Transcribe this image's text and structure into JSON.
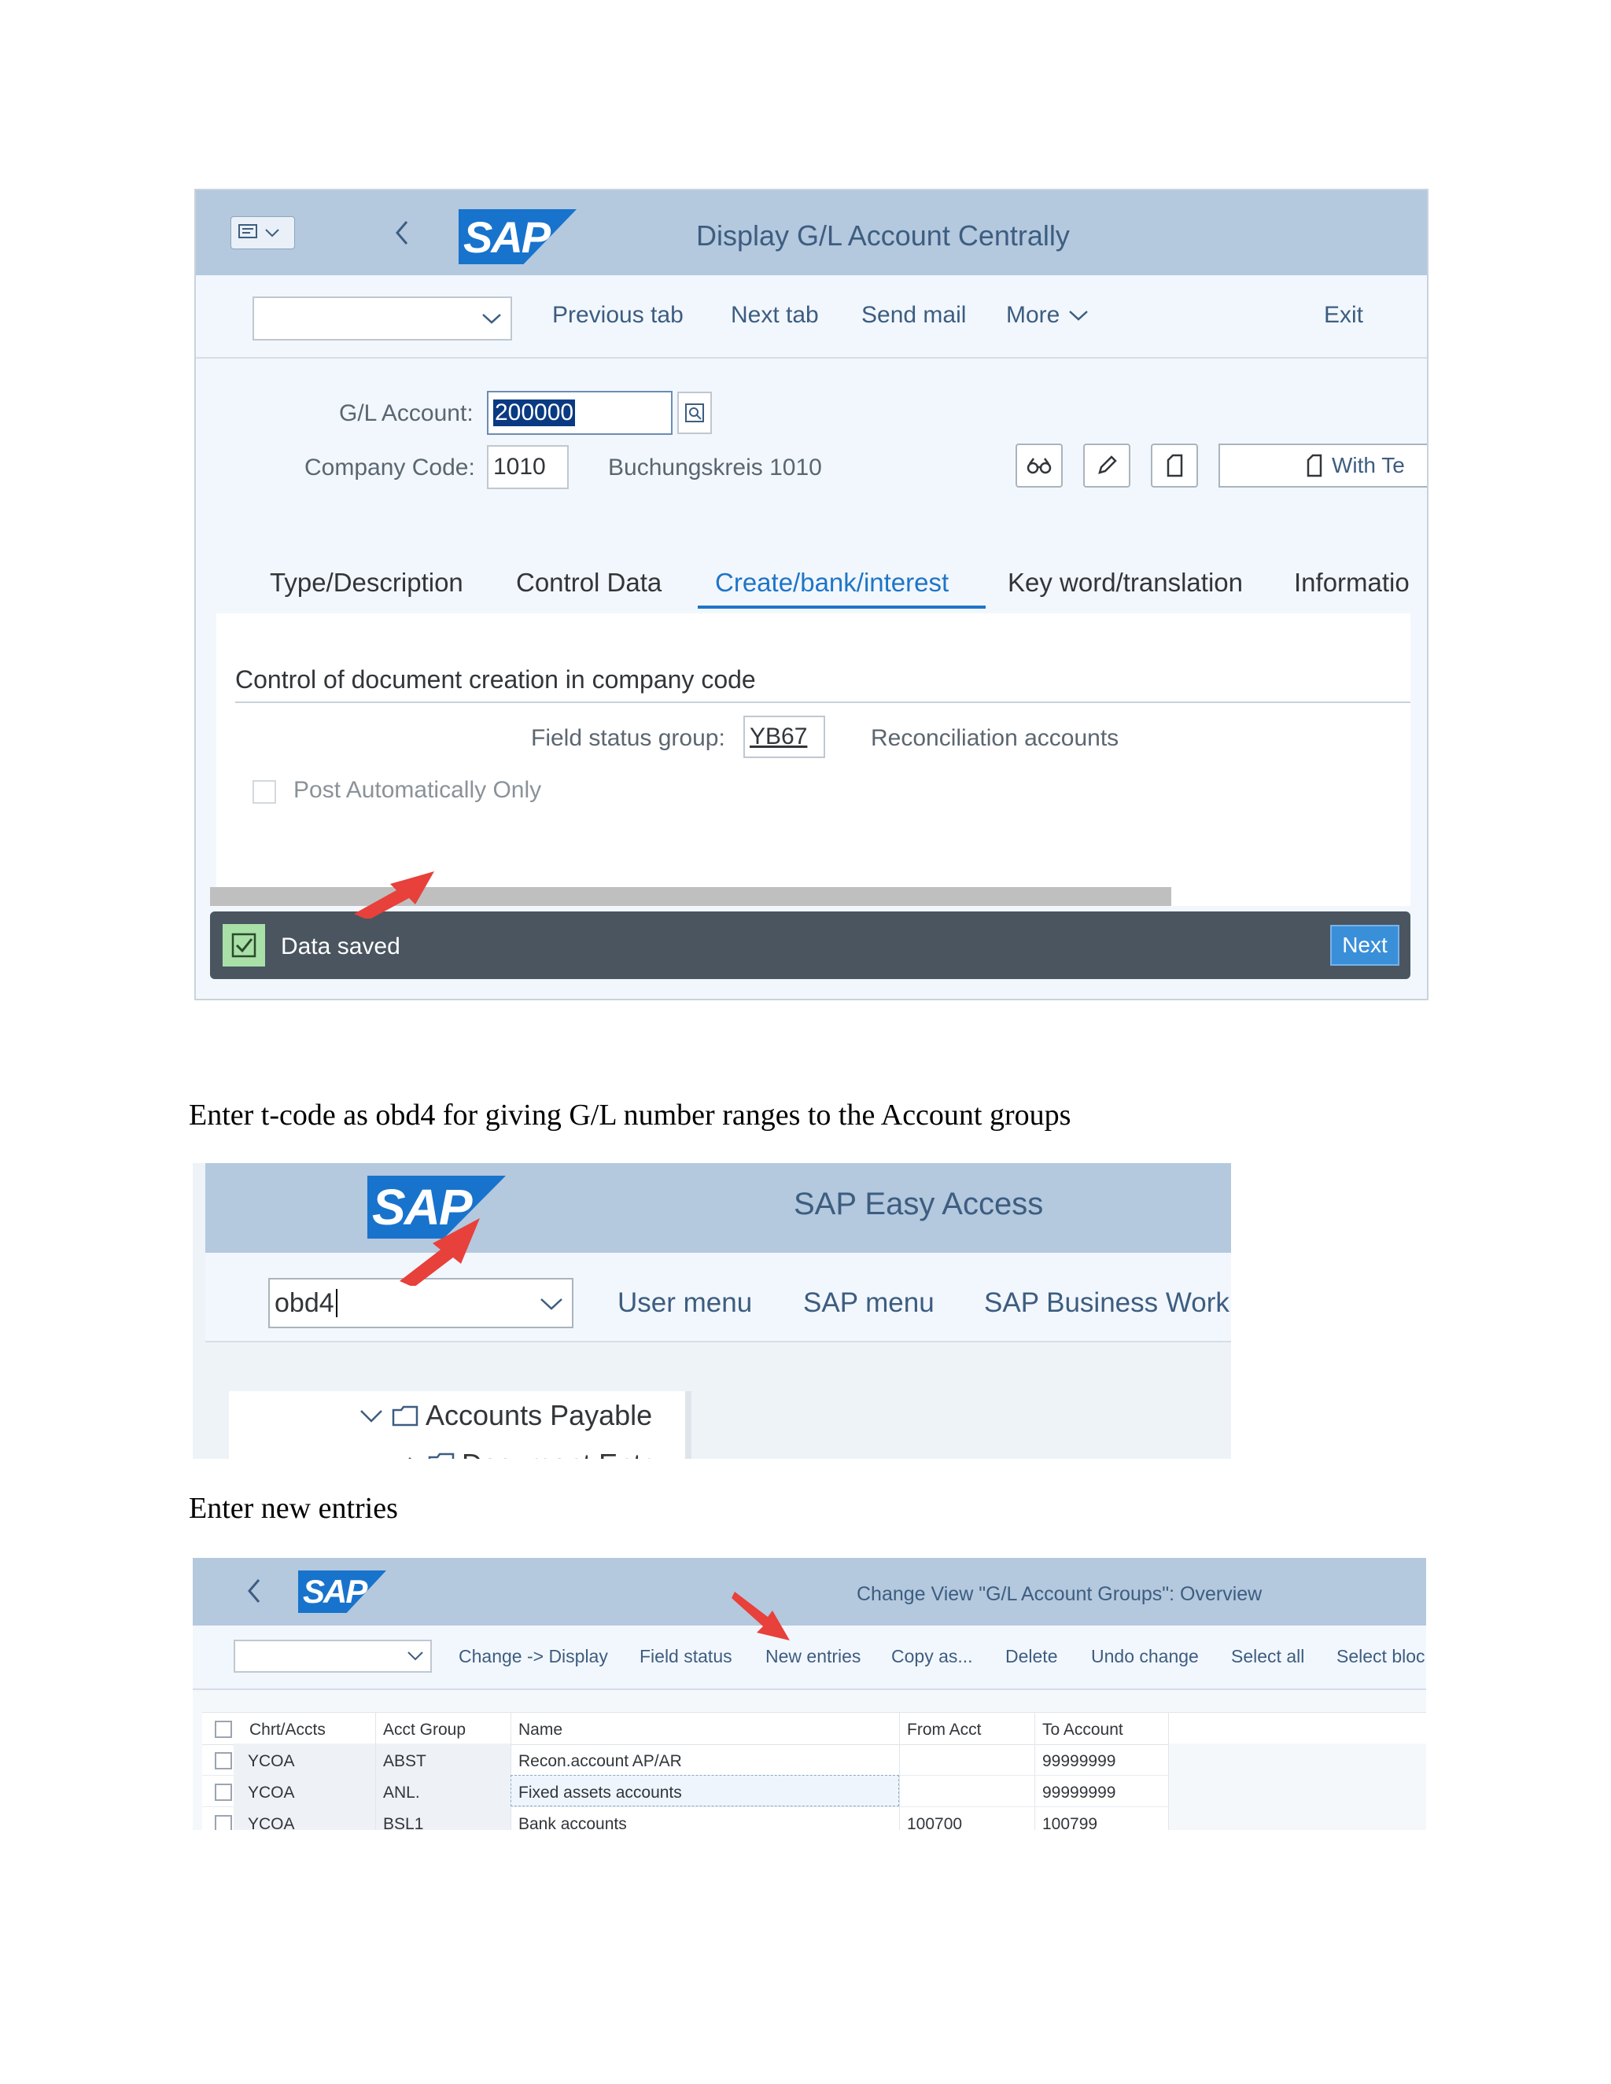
{
  "screen1": {
    "title": "Display G/L Account Centrally",
    "toolbar": {
      "previous_tab": "Previous tab",
      "next_tab": "Next tab",
      "send_mail": "Send mail",
      "more": "More",
      "exit": "Exit"
    },
    "gl_account_label": "G/L Account:",
    "gl_account_value": "200000",
    "company_code_label": "Company Code:",
    "company_code_value": "1010",
    "company_name": "Buchungskreis 1010",
    "with_template_button": "With Te",
    "tabs": [
      "Type/Description",
      "Control Data",
      "Create/bank/interest",
      "Key word/translation",
      "Informatio"
    ],
    "section_title": "Control of document creation in company code",
    "field_status_label": "Field status group:",
    "field_status_value": "YB67",
    "field_status_desc": "Reconciliation accounts",
    "post_auto_label": "Post Automatically Only",
    "message": "Data saved",
    "next_button": "Next"
  },
  "instruction1": "Enter t-code as obd4 for giving G/L number ranges to the Account groups",
  "screen2": {
    "title": "SAP Easy Access",
    "command_value": "obd4",
    "menu": [
      "User menu",
      "SAP menu",
      "SAP Business Work"
    ],
    "tree_item": "Accounts Payable",
    "tree_item_cut": "Document Entry"
  },
  "instruction2": "Enter new entries",
  "screen3": {
    "title": "Change View \"G/L Account Groups\": Overview",
    "toolbar": [
      "Change -> Display",
      "Field status",
      "New entries",
      "Copy as...",
      "Delete",
      "Undo change",
      "Select all",
      "Select bloc"
    ],
    "columns": [
      "Chrt/Accts",
      "Acct Group",
      "Name",
      "From Acct",
      "To Account"
    ],
    "rows": [
      {
        "chart": "YCOA",
        "group": "ABST",
        "name": "Recon.account AP/AR",
        "from": "",
        "to": "99999999"
      },
      {
        "chart": "YCOA",
        "group": "ANL.",
        "name": "Fixed assets accounts",
        "from": "",
        "to": "99999999"
      },
      {
        "chart": "YCOA",
        "group": "BSL1",
        "name": "Bank accounts",
        "from": "100700",
        "to": "100799"
      }
    ]
  },
  "logo_text": "SAP",
  "colors": {
    "shell": "#b4c8de",
    "accent_blue": "#1e75c8",
    "message_bar": "#4a5560",
    "success_green": "#a8e0a8",
    "arrow_red": "#e8403a"
  }
}
